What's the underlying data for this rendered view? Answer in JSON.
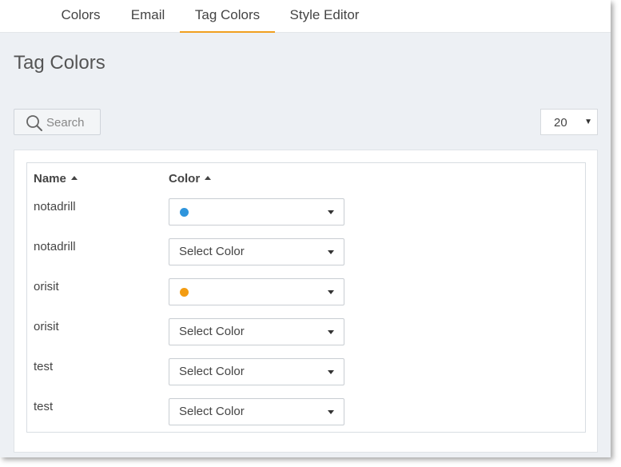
{
  "tabs": [
    {
      "label": "Colors",
      "active": false
    },
    {
      "label": "Email",
      "active": false
    },
    {
      "label": "Tag Colors",
      "active": true
    },
    {
      "label": "Style Editor",
      "active": false
    }
  ],
  "accent_color": "#f0a020",
  "page_title": "Tag Colors",
  "search": {
    "placeholder": "Search",
    "icon": "search-icon"
  },
  "page_size": {
    "value": "20"
  },
  "table": {
    "columns": [
      {
        "label": "Name",
        "sort": "ascending"
      },
      {
        "label": "Color",
        "sort": "ascending"
      }
    ],
    "rows": [
      {
        "name": "notadrill",
        "color_label": "",
        "swatch": "#2f95dc"
      },
      {
        "name": "notadrill",
        "color_label": "Select Color",
        "swatch": null
      },
      {
        "name": "orisit",
        "color_label": "",
        "swatch": "#f39c12"
      },
      {
        "name": "orisit",
        "color_label": "Select Color",
        "swatch": null
      },
      {
        "name": "test",
        "color_label": "Select Color",
        "swatch": null
      },
      {
        "name": "test",
        "color_label": "Select Color",
        "swatch": null
      }
    ]
  }
}
